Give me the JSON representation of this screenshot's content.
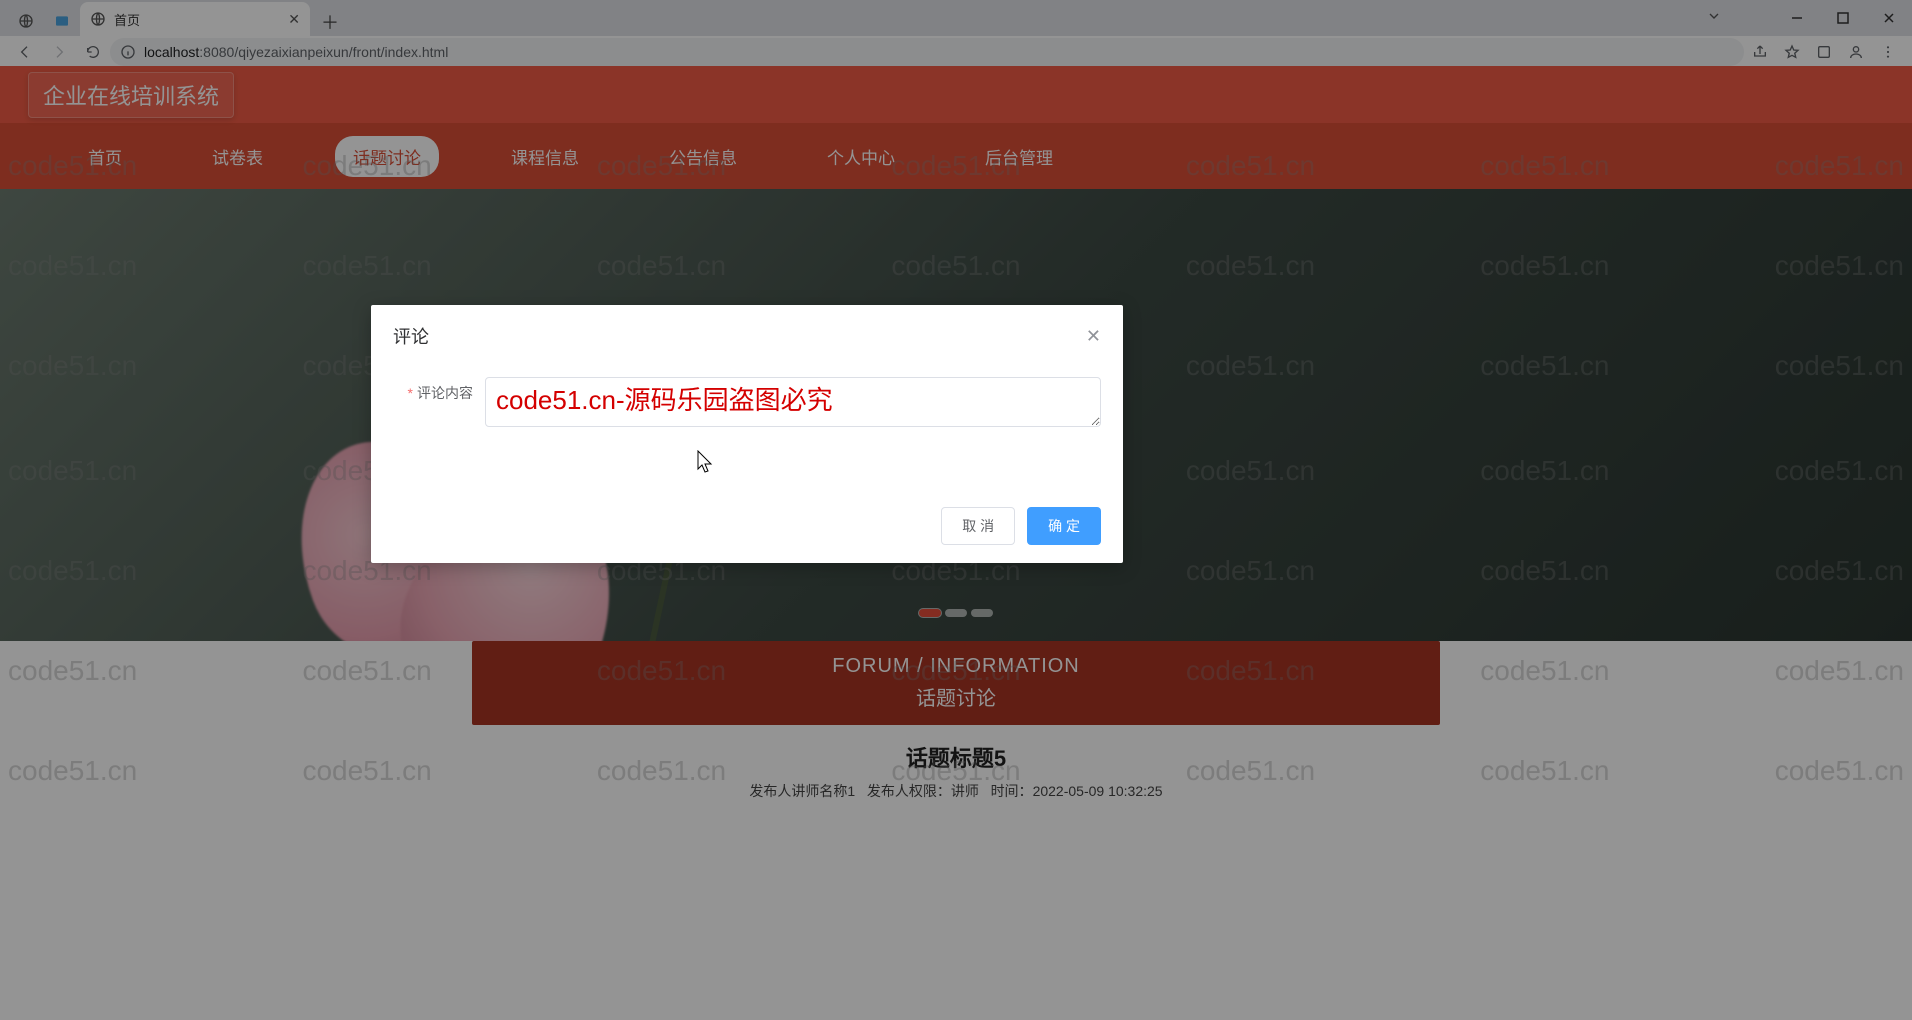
{
  "browser": {
    "tab_title": "首页",
    "url_host": "localhost",
    "url_port": ":8080",
    "url_path": "/qiyezaixianpeixun/front/index.html"
  },
  "header": {
    "logo": "企业在线培训系统",
    "nav": [
      "首页",
      "试卷表",
      "话题讨论",
      "课程信息",
      "公告信息",
      "个人中心",
      "后台管理"
    ],
    "active_index": 2
  },
  "section": {
    "en": "FORUM / INFORMATION",
    "cn": "话题讨论"
  },
  "post": {
    "title": "话题标题5",
    "meta_prefix_publisher": "发布人讲师名称1",
    "meta_role_label": "发布人权限：",
    "meta_role_value": "讲师",
    "meta_time_label": "时间：",
    "meta_time_value": "2022-05-09 10:32:25"
  },
  "dialog": {
    "title": "评论",
    "field_label": "评论内容",
    "textarea_value": "code51.cn-源码乐园盗图必究",
    "cancel": "取 消",
    "confirm": "确 定"
  },
  "watermark_text": "code51.cn"
}
